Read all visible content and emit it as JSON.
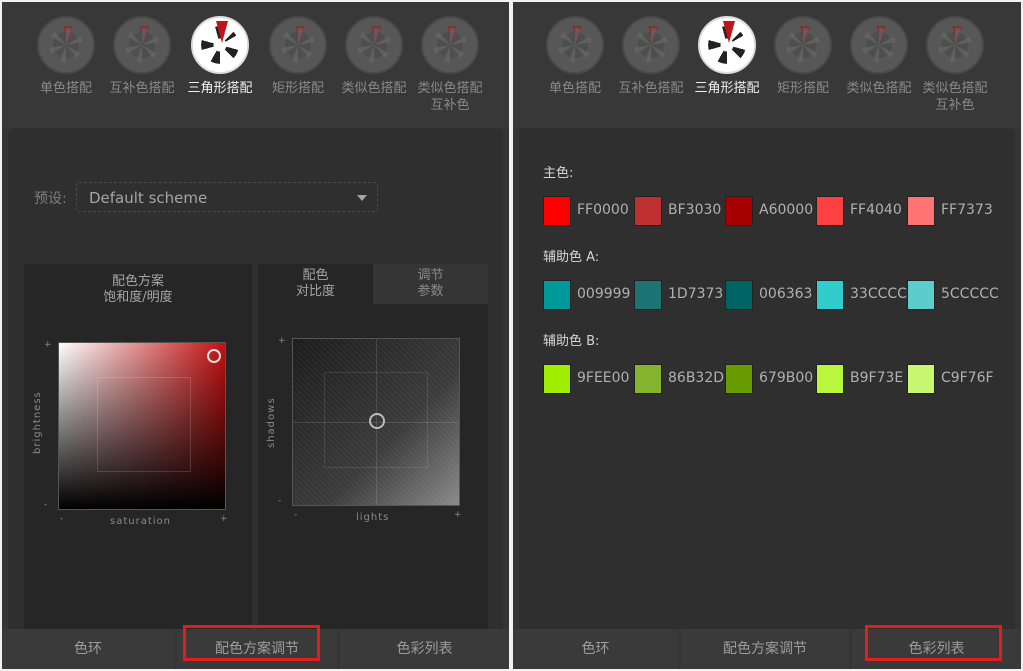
{
  "modes": [
    {
      "label": "单色搭配",
      "active": false
    },
    {
      "label": "互补色搭配",
      "active": false
    },
    {
      "label": "三角形搭配",
      "active": true
    },
    {
      "label": "矩形搭配",
      "active": false
    },
    {
      "label": "类似色搭配",
      "active": false
    },
    {
      "label": "类似色搭配互补色",
      "active": false
    }
  ],
  "left": {
    "preset": {
      "label": "预设:",
      "value": "Default scheme"
    },
    "sb_panel": {
      "title_line1": "配色方案",
      "title_line2": "饱和度/明度",
      "y_axis": "brightness",
      "x_axis": "saturation",
      "minus": "-",
      "plus": "+"
    },
    "contrast_panel": {
      "tab1_line1": "配色",
      "tab1_line2": "对比度",
      "tab2_line1": "调节",
      "tab2_line2": "参数",
      "y_axis": "shadows",
      "x_axis": "lights",
      "minus": "-",
      "plus": "+"
    },
    "tabs": [
      "色环",
      "配色方案调节",
      "色彩列表"
    ],
    "highlighted_tab": "配色方案调节"
  },
  "right": {
    "groups": [
      {
        "title": "主色:",
        "colors": [
          {
            "hex": "FF0000",
            "color": "#FF0000"
          },
          {
            "hex": "BF3030",
            "color": "#BF3030"
          },
          {
            "hex": "A60000",
            "color": "#A60000"
          },
          {
            "hex": "FF4040",
            "color": "#FF4040"
          },
          {
            "hex": "FF7373",
            "color": "#FF7373"
          }
        ]
      },
      {
        "title": "辅助色 A:",
        "colors": [
          {
            "hex": "009999",
            "color": "#009999"
          },
          {
            "hex": "1D7373",
            "color": "#1D7373"
          },
          {
            "hex": "006363",
            "color": "#006363"
          },
          {
            "hex": "33CCCC",
            "color": "#33CCCC"
          },
          {
            "hex": "5CCCCC",
            "color": "#5CCCCC"
          }
        ]
      },
      {
        "title": "辅助色 B:",
        "colors": [
          {
            "hex": "9FEE00",
            "color": "#9FEE00"
          },
          {
            "hex": "86B32D",
            "color": "#86B32D"
          },
          {
            "hex": "679B00",
            "color": "#679B00"
          },
          {
            "hex": "B9F73E",
            "color": "#B9F73E"
          },
          {
            "hex": "C9F76F",
            "color": "#C9F76F"
          }
        ]
      }
    ],
    "tabs": [
      "色环",
      "配色方案调节",
      "色彩列表"
    ],
    "highlighted_tab": "色彩列表"
  }
}
